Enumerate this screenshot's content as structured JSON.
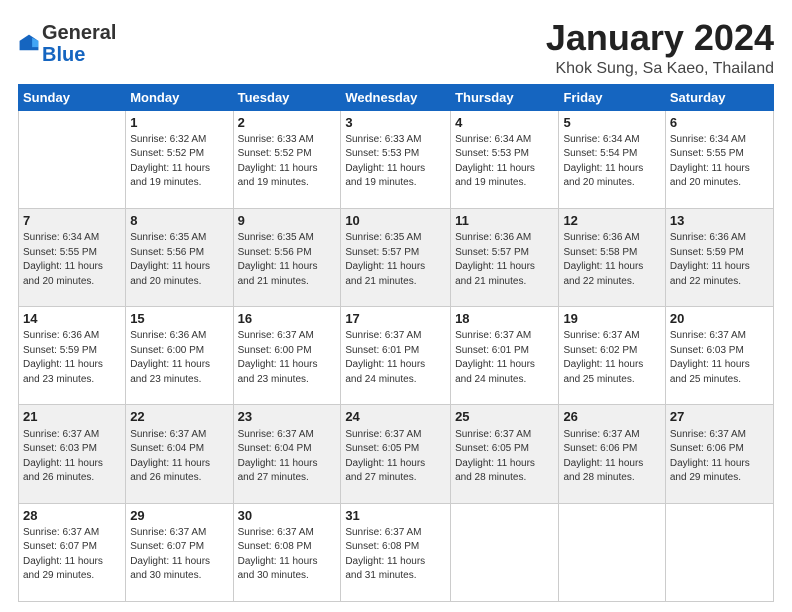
{
  "logo": {
    "general": "General",
    "blue": "Blue"
  },
  "header": {
    "month": "January 2024",
    "location": "Khok Sung, Sa Kaeo, Thailand"
  },
  "weekdays": [
    "Sunday",
    "Monday",
    "Tuesday",
    "Wednesday",
    "Thursday",
    "Friday",
    "Saturday"
  ],
  "weeks": [
    [
      {
        "day": "",
        "info": ""
      },
      {
        "day": "1",
        "info": "Sunrise: 6:32 AM\nSunset: 5:52 PM\nDaylight: 11 hours\nand 19 minutes."
      },
      {
        "day": "2",
        "info": "Sunrise: 6:33 AM\nSunset: 5:52 PM\nDaylight: 11 hours\nand 19 minutes."
      },
      {
        "day": "3",
        "info": "Sunrise: 6:33 AM\nSunset: 5:53 PM\nDaylight: 11 hours\nand 19 minutes."
      },
      {
        "day": "4",
        "info": "Sunrise: 6:34 AM\nSunset: 5:53 PM\nDaylight: 11 hours\nand 19 minutes."
      },
      {
        "day": "5",
        "info": "Sunrise: 6:34 AM\nSunset: 5:54 PM\nDaylight: 11 hours\nand 20 minutes."
      },
      {
        "day": "6",
        "info": "Sunrise: 6:34 AM\nSunset: 5:55 PM\nDaylight: 11 hours\nand 20 minutes."
      }
    ],
    [
      {
        "day": "7",
        "info": "Sunrise: 6:34 AM\nSunset: 5:55 PM\nDaylight: 11 hours\nand 20 minutes."
      },
      {
        "day": "8",
        "info": "Sunrise: 6:35 AM\nSunset: 5:56 PM\nDaylight: 11 hours\nand 20 minutes."
      },
      {
        "day": "9",
        "info": "Sunrise: 6:35 AM\nSunset: 5:56 PM\nDaylight: 11 hours\nand 21 minutes."
      },
      {
        "day": "10",
        "info": "Sunrise: 6:35 AM\nSunset: 5:57 PM\nDaylight: 11 hours\nand 21 minutes."
      },
      {
        "day": "11",
        "info": "Sunrise: 6:36 AM\nSunset: 5:57 PM\nDaylight: 11 hours\nand 21 minutes."
      },
      {
        "day": "12",
        "info": "Sunrise: 6:36 AM\nSunset: 5:58 PM\nDaylight: 11 hours\nand 22 minutes."
      },
      {
        "day": "13",
        "info": "Sunrise: 6:36 AM\nSunset: 5:59 PM\nDaylight: 11 hours\nand 22 minutes."
      }
    ],
    [
      {
        "day": "14",
        "info": "Sunrise: 6:36 AM\nSunset: 5:59 PM\nDaylight: 11 hours\nand 23 minutes."
      },
      {
        "day": "15",
        "info": "Sunrise: 6:36 AM\nSunset: 6:00 PM\nDaylight: 11 hours\nand 23 minutes."
      },
      {
        "day": "16",
        "info": "Sunrise: 6:37 AM\nSunset: 6:00 PM\nDaylight: 11 hours\nand 23 minutes."
      },
      {
        "day": "17",
        "info": "Sunrise: 6:37 AM\nSunset: 6:01 PM\nDaylight: 11 hours\nand 24 minutes."
      },
      {
        "day": "18",
        "info": "Sunrise: 6:37 AM\nSunset: 6:01 PM\nDaylight: 11 hours\nand 24 minutes."
      },
      {
        "day": "19",
        "info": "Sunrise: 6:37 AM\nSunset: 6:02 PM\nDaylight: 11 hours\nand 25 minutes."
      },
      {
        "day": "20",
        "info": "Sunrise: 6:37 AM\nSunset: 6:03 PM\nDaylight: 11 hours\nand 25 minutes."
      }
    ],
    [
      {
        "day": "21",
        "info": "Sunrise: 6:37 AM\nSunset: 6:03 PM\nDaylight: 11 hours\nand 26 minutes."
      },
      {
        "day": "22",
        "info": "Sunrise: 6:37 AM\nSunset: 6:04 PM\nDaylight: 11 hours\nand 26 minutes."
      },
      {
        "day": "23",
        "info": "Sunrise: 6:37 AM\nSunset: 6:04 PM\nDaylight: 11 hours\nand 27 minutes."
      },
      {
        "day": "24",
        "info": "Sunrise: 6:37 AM\nSunset: 6:05 PM\nDaylight: 11 hours\nand 27 minutes."
      },
      {
        "day": "25",
        "info": "Sunrise: 6:37 AM\nSunset: 6:05 PM\nDaylight: 11 hours\nand 28 minutes."
      },
      {
        "day": "26",
        "info": "Sunrise: 6:37 AM\nSunset: 6:06 PM\nDaylight: 11 hours\nand 28 minutes."
      },
      {
        "day": "27",
        "info": "Sunrise: 6:37 AM\nSunset: 6:06 PM\nDaylight: 11 hours\nand 29 minutes."
      }
    ],
    [
      {
        "day": "28",
        "info": "Sunrise: 6:37 AM\nSunset: 6:07 PM\nDaylight: 11 hours\nand 29 minutes."
      },
      {
        "day": "29",
        "info": "Sunrise: 6:37 AM\nSunset: 6:07 PM\nDaylight: 11 hours\nand 30 minutes."
      },
      {
        "day": "30",
        "info": "Sunrise: 6:37 AM\nSunset: 6:08 PM\nDaylight: 11 hours\nand 30 minutes."
      },
      {
        "day": "31",
        "info": "Sunrise: 6:37 AM\nSunset: 6:08 PM\nDaylight: 11 hours\nand 31 minutes."
      },
      {
        "day": "",
        "info": ""
      },
      {
        "day": "",
        "info": ""
      },
      {
        "day": "",
        "info": ""
      }
    ]
  ]
}
